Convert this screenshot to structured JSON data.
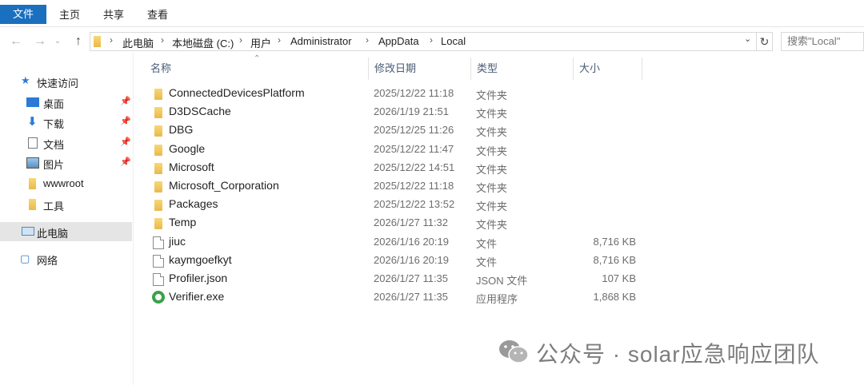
{
  "ribbon": {
    "tabs": [
      "文件",
      "主页",
      "共享",
      "查看"
    ]
  },
  "address": {
    "crumbs": [
      "此电脑",
      "本地磁盘 (C:)",
      "用户",
      "Administrator",
      "AppData",
      "Local"
    ],
    "search_placeholder": "搜索\"Local\""
  },
  "nav": {
    "quick_access": "快速访问",
    "items": [
      {
        "label": "桌面",
        "icon": "desktop-icon",
        "pinned": true
      },
      {
        "label": "下载",
        "icon": "download-icon",
        "pinned": true
      },
      {
        "label": "文档",
        "icon": "document-icon",
        "pinned": true
      },
      {
        "label": "图片",
        "icon": "picture-icon",
        "pinned": true
      },
      {
        "label": "wwwroot",
        "icon": "folder-icon",
        "pinned": false
      },
      {
        "label": "工具",
        "icon": "folder-icon",
        "pinned": false
      }
    ],
    "this_pc": "此电脑",
    "network": "网络"
  },
  "columns": {
    "name": "名称",
    "date": "修改日期",
    "type": "类型",
    "size": "大小"
  },
  "files": [
    {
      "name": "ConnectedDevicesPlatform",
      "date": "2025/12/22 11:18",
      "type": "文件夹",
      "size": "",
      "icon": "folder-icon"
    },
    {
      "name": "D3DSCache",
      "date": "2026/1/19 21:51",
      "type": "文件夹",
      "size": "",
      "icon": "folder-icon"
    },
    {
      "name": "DBG",
      "date": "2025/12/25 11:26",
      "type": "文件夹",
      "size": "",
      "icon": "folder-icon"
    },
    {
      "name": "Google",
      "date": "2025/12/22 11:47",
      "type": "文件夹",
      "size": "",
      "icon": "folder-icon"
    },
    {
      "name": "Microsoft",
      "date": "2025/12/22 14:51",
      "type": "文件夹",
      "size": "",
      "icon": "folder-icon"
    },
    {
      "name": "Microsoft_Corporation",
      "date": "2025/12/22 11:18",
      "type": "文件夹",
      "size": "",
      "icon": "folder-icon"
    },
    {
      "name": "Packages",
      "date": "2025/12/22 13:52",
      "type": "文件夹",
      "size": "",
      "icon": "folder-icon"
    },
    {
      "name": "Temp",
      "date": "2026/1/27 11:32",
      "type": "文件夹",
      "size": "",
      "icon": "folder-icon"
    },
    {
      "name": "jiuc",
      "date": "2026/1/16 20:19",
      "type": "文件",
      "size": "8,716 KB",
      "icon": "file-icon"
    },
    {
      "name": "kaymgoefkyt",
      "date": "2026/1/16 20:19",
      "type": "文件",
      "size": "8,716 KB",
      "icon": "file-icon"
    },
    {
      "name": "Profiler.json",
      "date": "2026/1/27 11:35",
      "type": "JSON 文件",
      "size": "107 KB",
      "icon": "file-icon"
    },
    {
      "name": "Verifier.exe",
      "date": "2026/1/27 11:35",
      "type": "应用程序",
      "size": "1,868 KB",
      "icon": "exe-icon"
    }
  ],
  "watermark": {
    "text": "公众号 · solar应急响应团队"
  }
}
